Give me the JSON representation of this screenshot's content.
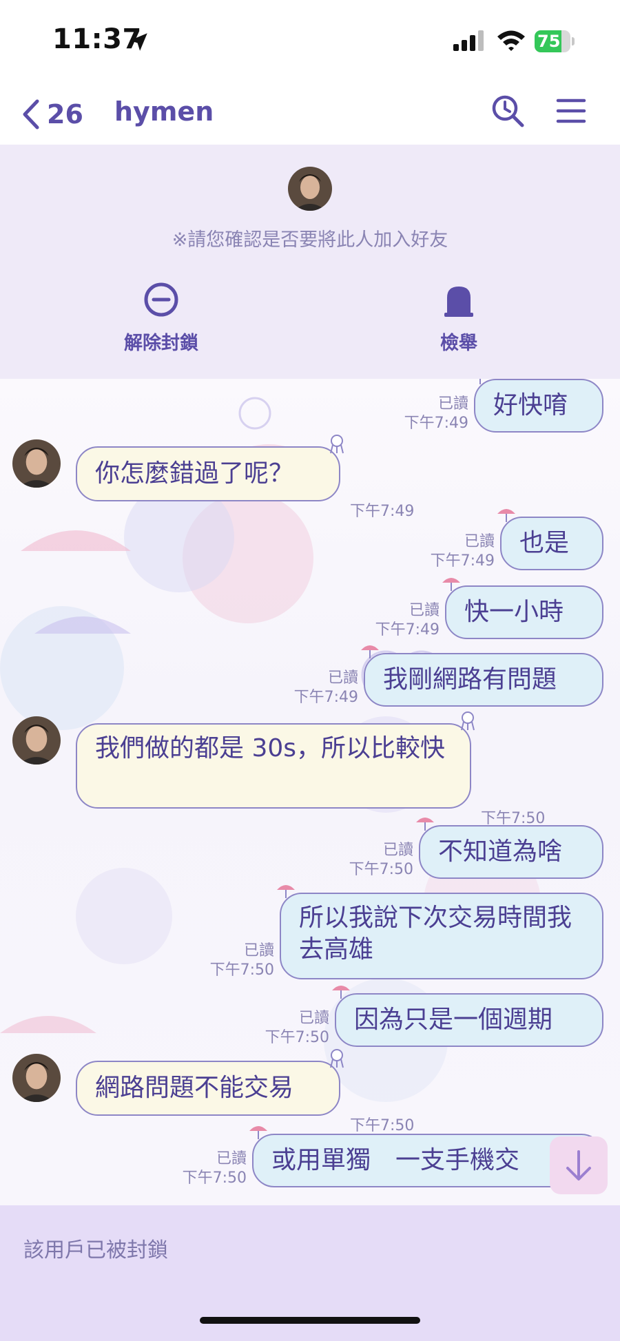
{
  "status_bar": {
    "time": "11:37",
    "battery": "75",
    "battery_level": 0.75,
    "icons": [
      "location-arrow-icon",
      "signal-icon",
      "wifi-icon",
      "battery-charging-icon"
    ]
  },
  "nav": {
    "back_count": "26",
    "title": "hymen",
    "icons": [
      "chevron-left-icon",
      "search-icon",
      "menu-icon"
    ]
  },
  "block_panel": {
    "notice": "※請您確認是否要將此人加入好友",
    "unblock_label": "解除封鎖",
    "report_label": "檢舉",
    "icons": [
      "minus-circle-icon",
      "report-bell-icon"
    ]
  },
  "messages": [
    {
      "dir": "out",
      "text": "好快唷",
      "read": "已讀",
      "time": "下午7:49"
    },
    {
      "dir": "in",
      "text": "你怎麼錯過了呢？",
      "time": "下午7:49"
    },
    {
      "dir": "out",
      "text": "也是",
      "read": "已讀",
      "time": "下午7:49"
    },
    {
      "dir": "out",
      "text": "快一小時",
      "read": "已讀",
      "time": "下午7:49"
    },
    {
      "dir": "out",
      "text": "我剛網路有問題",
      "read": "已讀",
      "time": "下午7:49"
    },
    {
      "dir": "in",
      "text": "我們做的都是 30s，所以比較快",
      "time": "下午7:50"
    },
    {
      "dir": "out",
      "text": "不知道為啥",
      "read": "已讀",
      "time": "下午7:50"
    },
    {
      "dir": "out",
      "text": "所以我說下次交易時間我去高雄",
      "read": "已讀",
      "time": "下午7:50"
    },
    {
      "dir": "out",
      "text": "因為只是一個週期",
      "read": "已讀",
      "time": "下午7:50"
    },
    {
      "dir": "in",
      "text": "網路問題不能交易",
      "time": "下午7:50"
    },
    {
      "dir": "out",
      "text": "或用單獨　一支手機交",
      "read": "已讀",
      "time": "下午7:50"
    }
  ],
  "footer": {
    "blocked_text": "該用戶已被封鎖"
  },
  "colors": {
    "accent": "#5b4ea8",
    "bubble_out": "#dff0f8",
    "bubble_in": "#fbf8e6",
    "panel_bg": "#efeaf8",
    "footer_bg": "#e5dcf7",
    "battery_green": "#34c759"
  }
}
